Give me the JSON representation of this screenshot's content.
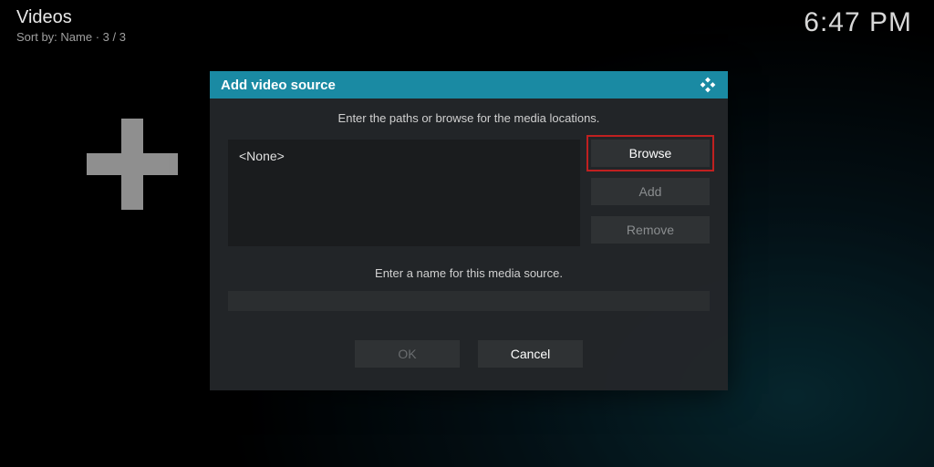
{
  "header": {
    "title": "Videos",
    "sort_line": "Sort by: Name  ·  3 / 3"
  },
  "clock": "6:47 PM",
  "dialog": {
    "title": "Add video source",
    "instruction": "Enter the paths or browse for the media locations.",
    "path_value": "<None>",
    "buttons": {
      "browse": "Browse",
      "add": "Add",
      "remove": "Remove"
    },
    "name_label": "Enter a name for this media source.",
    "name_value": "",
    "footer": {
      "ok": "OK",
      "cancel": "Cancel"
    }
  },
  "colors": {
    "accent": "#1a8aa3",
    "highlight": "#c02020"
  }
}
